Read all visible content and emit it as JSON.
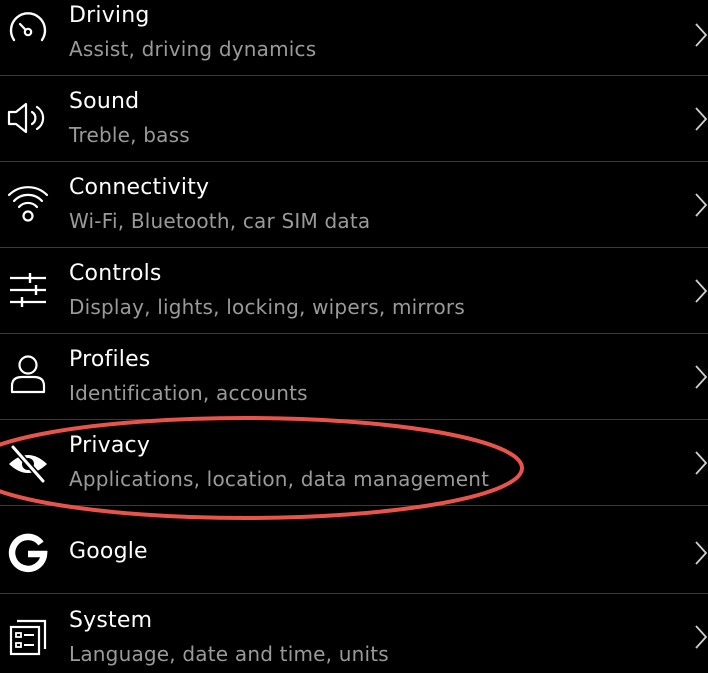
{
  "settings": {
    "items": [
      {
        "title": "Driving",
        "subtitle": "Assist, driving dynamics",
        "icon": "gauge-icon"
      },
      {
        "title": "Sound",
        "subtitle": "Treble, bass",
        "icon": "speaker-icon"
      },
      {
        "title": "Connectivity",
        "subtitle": "Wi-Fi, Bluetooth, car SIM data",
        "icon": "wifi-icon"
      },
      {
        "title": "Controls",
        "subtitle": "Display, lights, locking, wipers, mirrors",
        "icon": "sliders-icon"
      },
      {
        "title": "Profiles",
        "subtitle": "Identification, accounts",
        "icon": "person-icon"
      },
      {
        "title": "Privacy",
        "subtitle": "Applications, location, data management",
        "icon": "eye-off-icon"
      },
      {
        "title": "Google",
        "subtitle": "",
        "icon": "google-icon"
      },
      {
        "title": "System",
        "subtitle": "Language, date and time, units",
        "icon": "system-icon"
      }
    ]
  },
  "colors": {
    "background": "#000000",
    "title": "#ffffff",
    "subtitle": "#9a9a9a",
    "divider": "#3a3a3a",
    "annotation": "#e8544a"
  }
}
